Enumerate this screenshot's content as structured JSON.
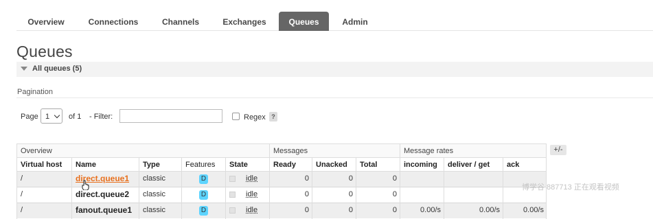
{
  "nav": {
    "tabs": [
      {
        "label": "Overview",
        "active": false
      },
      {
        "label": "Connections",
        "active": false
      },
      {
        "label": "Channels",
        "active": false
      },
      {
        "label": "Exchanges",
        "active": false
      },
      {
        "label": "Queues",
        "active": true
      },
      {
        "label": "Admin",
        "active": false
      }
    ]
  },
  "page": {
    "title": "Queues",
    "section_label": "All queues (5)"
  },
  "pagination": {
    "heading": "Pagination",
    "page_label": "Page",
    "page_value": "1",
    "of_label": "of 1",
    "filter_label": "- Filter:",
    "filter_value": "",
    "regex_label": "Regex",
    "help_label": "?"
  },
  "table": {
    "groups": {
      "overview": "Overview",
      "messages": "Messages",
      "rates": "Message rates"
    },
    "columns": {
      "vhost": "Virtual host",
      "name": "Name",
      "type": "Type",
      "features": "Features",
      "state": "State",
      "ready": "Ready",
      "unacked": "Unacked",
      "total": "Total",
      "incoming": "incoming",
      "deliver": "deliver / get",
      "ack": "ack"
    },
    "toggle_label": "+/-",
    "rows": [
      {
        "vhost": "/",
        "name": "direct.queue1",
        "type": "classic",
        "feature": "D",
        "state": "idle",
        "ready": "0",
        "unacked": "0",
        "total": "0",
        "incoming": "",
        "deliver": "",
        "ack": ""
      },
      {
        "vhost": "/",
        "name": "direct.queue2",
        "type": "classic",
        "feature": "D",
        "state": "idle",
        "ready": "0",
        "unacked": "0",
        "total": "0",
        "incoming": "",
        "deliver": "",
        "ack": ""
      },
      {
        "vhost": "/",
        "name": "fanout.queue1",
        "type": "classic",
        "feature": "D",
        "state": "idle",
        "ready": "0",
        "unacked": "0",
        "total": "0",
        "incoming": "0.00/s",
        "deliver": "0.00/s",
        "ack": "0.00/s"
      }
    ]
  },
  "overlay": {
    "watermark": "博学谷 887713 正在观看视频"
  },
  "colors": {
    "active_tab": "#666666",
    "link": "#e86f1c",
    "badge": "#5dd4ff"
  }
}
